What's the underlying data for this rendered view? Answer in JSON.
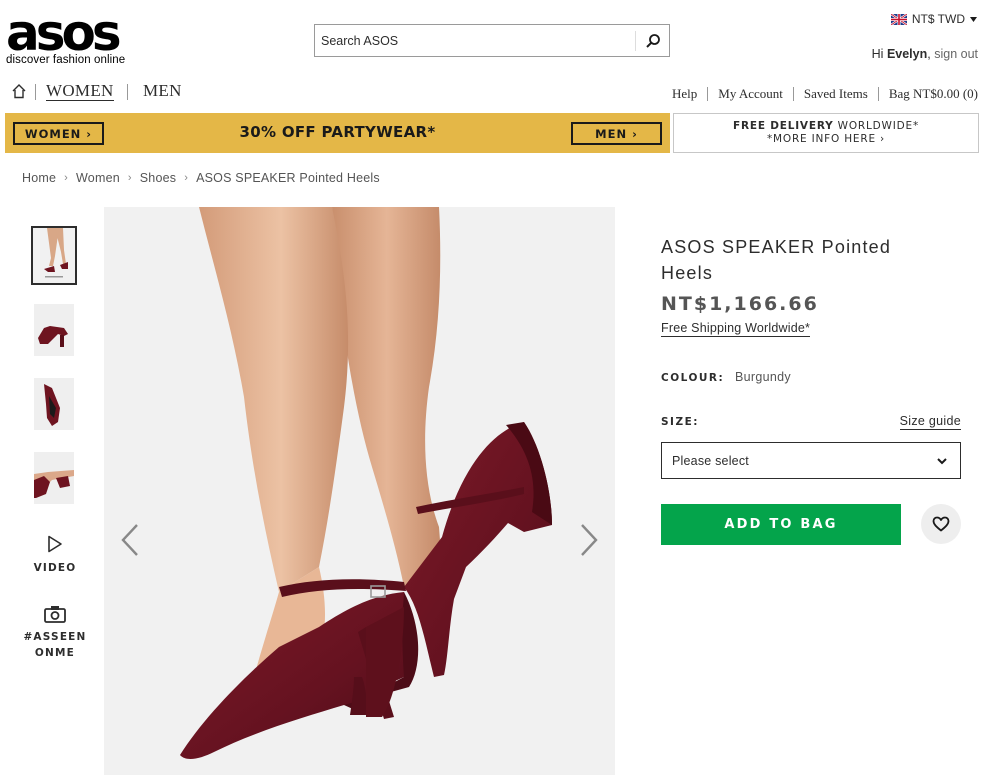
{
  "header": {
    "logo_text": "asos",
    "logo_tagline": "discover fashion online",
    "search_placeholder": "Search ASOS",
    "currency": "NT$ TWD",
    "greeting_prefix": "Hi ",
    "user_name": "Evelyn",
    "greeting_comma": ",",
    "sign_out": "sign out"
  },
  "nav": {
    "women": "WOMEN",
    "men": "MEN",
    "help": "Help",
    "my_account": "My Account",
    "saved_items": "Saved Items",
    "bag": "Bag NT$0.00 (0)"
  },
  "promo": {
    "women_btn": "WOMEN ›",
    "men_btn": "MEN ›",
    "text": "30% OFF PARTYWEAR*",
    "delivery_bold": "FREE DELIVERY",
    "delivery_rest": " WORLDWIDE*",
    "delivery_more": "*MORE INFO HERE ›"
  },
  "breadcrumb": [
    {
      "label": "Home"
    },
    {
      "label": "Women"
    },
    {
      "label": "Shoes"
    },
    {
      "label": "ASOS SPEAKER Pointed Heels"
    }
  ],
  "gallery": {
    "video_label": "VIDEO",
    "asseen_line1": "#ASSEEN",
    "asseen_line2": "ONME"
  },
  "product": {
    "title": "ASOS SPEAKER Pointed Heels",
    "price": "NT$1,166.66",
    "shipping": "Free Shipping Worldwide*",
    "colour_label": "COLOUR:",
    "colour_value": "Burgundy",
    "size_label": "SIZE:",
    "size_guide": "Size guide",
    "size_placeholder": "Please select",
    "add_to_bag": "ADD TO BAG"
  },
  "colors": {
    "promo_bg": "#e4b747",
    "add_to_bag": "#04a44b",
    "shoe": "#6e1420",
    "text": "#2d2d2d"
  },
  "icons": [
    "home-icon",
    "search-icon",
    "uk-flag-icon",
    "caret-down-icon",
    "play-icon",
    "camera-icon",
    "chevron-left-icon",
    "chevron-right-icon",
    "chevron-down-icon",
    "heart-icon"
  ]
}
